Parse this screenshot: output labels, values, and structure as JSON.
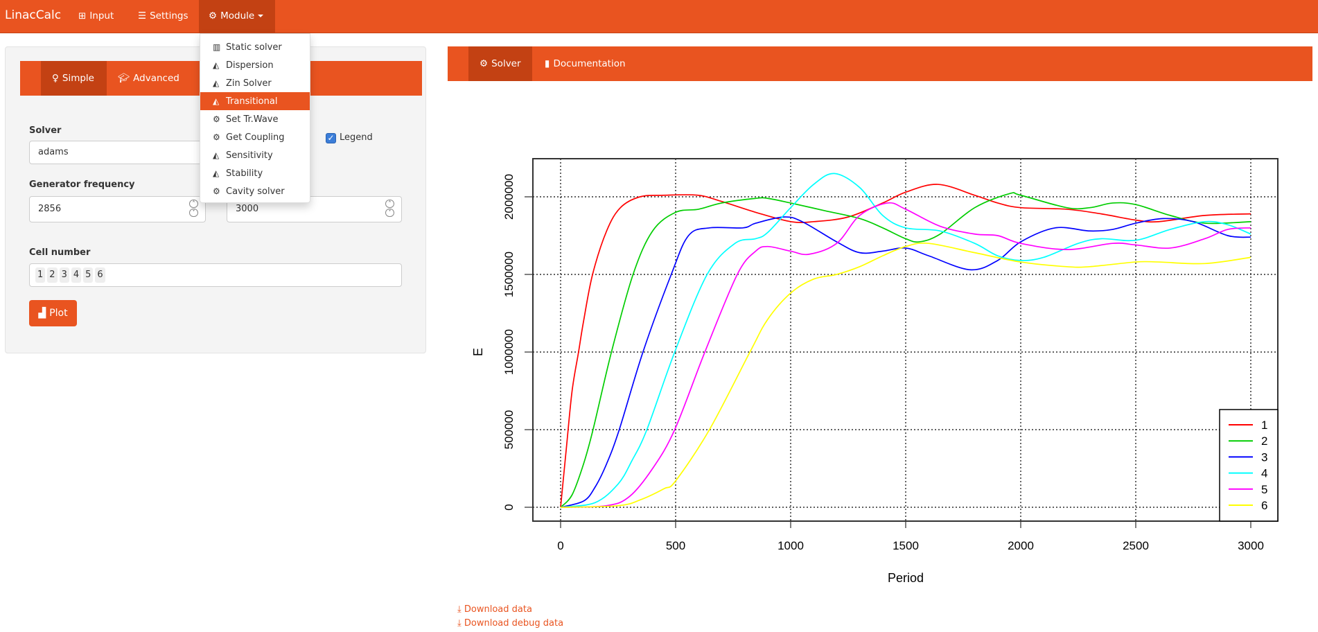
{
  "navbar": {
    "brand": "LinacCalc",
    "items": [
      {
        "label": "Input",
        "icon": "table-icon"
      },
      {
        "label": "Settings",
        "icon": "sliders-icon"
      },
      {
        "label": "Module",
        "icon": "cogs-icon",
        "active": true
      }
    ]
  },
  "module_menu": {
    "items": [
      {
        "label": "Static solver",
        "icon": "bar-chart-icon"
      },
      {
        "label": "Dispersion",
        "icon": "area-chart-icon"
      },
      {
        "label": "Zin Solver",
        "icon": "area-chart-icon"
      },
      {
        "label": "Transitional",
        "icon": "area-chart-icon",
        "active": true
      },
      {
        "label": "Set Tr.Wave",
        "icon": "gear-icon"
      },
      {
        "label": "Get Coupling",
        "icon": "gear-icon"
      },
      {
        "label": "Sensitivity",
        "icon": "area-chart-icon"
      },
      {
        "label": "Stability",
        "icon": "area-chart-icon"
      },
      {
        "label": "Cavity solver",
        "icon": "gear-icon"
      }
    ]
  },
  "left_panel": {
    "tabs": [
      {
        "label": "Simple",
        "icon": "child-icon",
        "active": true
      },
      {
        "label": "Advanced",
        "icon": "graduation-cap-icon"
      },
      {
        "label": "",
        "icon": "list-icon"
      }
    ],
    "solver_label": "Solver",
    "solver_value": "adams",
    "legend_label": "Legend",
    "legend_checked": true,
    "generator_frequency_label": "Generator frequency",
    "generator_frequency_value": "2856",
    "second_value": "3000",
    "cell_number_label": "Cell number",
    "cells": [
      "1",
      "2",
      "3",
      "4",
      "5",
      "6"
    ],
    "plot_button": "Plot"
  },
  "right_panel": {
    "tabs": [
      {
        "label": "Solver",
        "icon": "gear-icon",
        "active": true
      },
      {
        "label": "Documentation",
        "icon": "file-icon"
      }
    ],
    "download_data": "Download data",
    "download_debug": "Download debug data"
  },
  "colors": {
    "brand": "#e95420",
    "brand_dark": "#c34113"
  },
  "chart_data": {
    "type": "line",
    "xlabel": "Period",
    "ylabel": "E",
    "xlim": [
      0,
      3000
    ],
    "ylim": [
      0,
      2150000
    ],
    "xticks": [
      0,
      500,
      1000,
      1500,
      2000,
      2500,
      3000
    ],
    "yticks": [
      0,
      500000,
      1000000,
      1500000,
      2000000
    ],
    "grid": true,
    "legend_position": "bottom-right",
    "series": [
      {
        "name": "1",
        "color": "#ff0000",
        "points": [
          [
            0,
            0
          ],
          [
            25,
            380000
          ],
          [
            50,
            750000
          ],
          [
            78,
            1000000
          ],
          [
            100,
            1200000
          ],
          [
            139,
            1500000
          ],
          [
            200,
            1780000
          ],
          [
            260,
            1930000
          ],
          [
            345,
            2000000
          ],
          [
            450,
            2010000
          ],
          [
            597,
            2010000
          ],
          [
            700,
            1970000
          ],
          [
            848,
            1900000
          ],
          [
            1000,
            1840000
          ],
          [
            1100,
            1840000
          ],
          [
            1250,
            1870000
          ],
          [
            1400,
            1960000
          ],
          [
            1500,
            2030000
          ],
          [
            1640,
            2080000
          ],
          [
            1800,
            2010000
          ],
          [
            1900,
            1960000
          ],
          [
            2000,
            1930000
          ],
          [
            2200,
            1920000
          ],
          [
            2350,
            1890000
          ],
          [
            2500,
            1850000
          ],
          [
            2600,
            1840000
          ],
          [
            2800,
            1880000
          ],
          [
            3000,
            1890000
          ]
        ]
      },
      {
        "name": "2",
        "color": "#00cd00",
        "points": [
          [
            0,
            0
          ],
          [
            50,
            80000
          ],
          [
            100,
            280000
          ],
          [
            141,
            500000
          ],
          [
            221,
            1000000
          ],
          [
            315,
            1500000
          ],
          [
            400,
            1780000
          ],
          [
            500,
            1900000
          ],
          [
            600,
            1920000
          ],
          [
            700,
            1960000
          ],
          [
            848,
            1990000
          ],
          [
            900,
            1990000
          ],
          [
            1000,
            1960000
          ],
          [
            1150,
            1910000
          ],
          [
            1300,
            1860000
          ],
          [
            1400,
            1800000
          ],
          [
            1500,
            1730000
          ],
          [
            1560,
            1710000
          ],
          [
            1650,
            1760000
          ],
          [
            1800,
            1930000
          ],
          [
            1950,
            2020000
          ],
          [
            2000,
            2010000
          ],
          [
            2200,
            1930000
          ],
          [
            2300,
            1930000
          ],
          [
            2400,
            1960000
          ],
          [
            2500,
            1950000
          ],
          [
            2650,
            1880000
          ],
          [
            2800,
            1830000
          ],
          [
            3000,
            1840000
          ]
        ]
      },
      {
        "name": "3",
        "color": "#0000ff",
        "points": [
          [
            0,
            0
          ],
          [
            100,
            40000
          ],
          [
            150,
            130000
          ],
          [
            200,
            280000
          ],
          [
            255,
            500000
          ],
          [
            358,
            1000000
          ],
          [
            481,
            1500000
          ],
          [
            556,
            1750000
          ],
          [
            647,
            1800000
          ],
          [
            793,
            1800000
          ],
          [
            848,
            1830000
          ],
          [
            970,
            1870000
          ],
          [
            1050,
            1840000
          ],
          [
            1200,
            1710000
          ],
          [
            1300,
            1640000
          ],
          [
            1400,
            1650000
          ],
          [
            1500,
            1670000
          ],
          [
            1600,
            1620000
          ],
          [
            1780,
            1530000
          ],
          [
            1900,
            1590000
          ],
          [
            2000,
            1710000
          ],
          [
            2150,
            1800000
          ],
          [
            2300,
            1780000
          ],
          [
            2400,
            1790000
          ],
          [
            2500,
            1830000
          ],
          [
            2620,
            1860000
          ],
          [
            2750,
            1840000
          ],
          [
            2900,
            1750000
          ],
          [
            3000,
            1740000
          ]
        ]
      },
      {
        "name": "4",
        "color": "#00ffff",
        "points": [
          [
            0,
            0
          ],
          [
            150,
            30000
          ],
          [
            250,
            150000
          ],
          [
            310,
            300000
          ],
          [
            375,
            500000
          ],
          [
            496,
            1000000
          ],
          [
            637,
            1500000
          ],
          [
            758,
            1700000
          ],
          [
            848,
            1730000
          ],
          [
            900,
            1770000
          ],
          [
            1000,
            1930000
          ],
          [
            1100,
            2080000
          ],
          [
            1190,
            2150000
          ],
          [
            1300,
            2060000
          ],
          [
            1400,
            1880000
          ],
          [
            1500,
            1800000
          ],
          [
            1650,
            1780000
          ],
          [
            1800,
            1700000
          ],
          [
            1900,
            1620000
          ],
          [
            2000,
            1590000
          ],
          [
            2100,
            1610000
          ],
          [
            2250,
            1700000
          ],
          [
            2350,
            1730000
          ],
          [
            2500,
            1720000
          ],
          [
            2650,
            1790000
          ],
          [
            2800,
            1840000
          ],
          [
            2900,
            1820000
          ],
          [
            3000,
            1760000
          ]
        ]
      },
      {
        "name": "5",
        "color": "#ff00ff",
        "points": [
          [
            0,
            0
          ],
          [
            200,
            10000
          ],
          [
            300,
            70000
          ],
          [
            400,
            250000
          ],
          [
            496,
            500000
          ],
          [
            627,
            1000000
          ],
          [
            768,
            1500000
          ],
          [
            848,
            1650000
          ],
          [
            900,
            1680000
          ],
          [
            1000,
            1650000
          ],
          [
            1080,
            1630000
          ],
          [
            1200,
            1700000
          ],
          [
            1300,
            1880000
          ],
          [
            1420,
            1960000
          ],
          [
            1500,
            1920000
          ],
          [
            1650,
            1810000
          ],
          [
            1800,
            1760000
          ],
          [
            1900,
            1750000
          ],
          [
            2000,
            1700000
          ],
          [
            2200,
            1660000
          ],
          [
            2400,
            1700000
          ],
          [
            2500,
            1690000
          ],
          [
            2650,
            1670000
          ],
          [
            2800,
            1730000
          ],
          [
            2900,
            1790000
          ],
          [
            3000,
            1800000
          ]
        ]
      },
      {
        "name": "6",
        "color": "#ffff00",
        "points": [
          [
            0,
            0
          ],
          [
            250,
            10000
          ],
          [
            350,
            50000
          ],
          [
            450,
            120000
          ],
          [
            500,
            170000
          ],
          [
            647,
            500000
          ],
          [
            823,
            1000000
          ],
          [
            900,
            1210000
          ],
          [
            1000,
            1380000
          ],
          [
            1100,
            1470000
          ],
          [
            1200,
            1500000
          ],
          [
            1300,
            1550000
          ],
          [
            1400,
            1620000
          ],
          [
            1500,
            1680000
          ],
          [
            1600,
            1700000
          ],
          [
            1800,
            1640000
          ],
          [
            2000,
            1580000
          ],
          [
            2200,
            1550000
          ],
          [
            2300,
            1550000
          ],
          [
            2500,
            1580000
          ],
          [
            2600,
            1580000
          ],
          [
            2800,
            1570000
          ],
          [
            3000,
            1610000
          ]
        ]
      }
    ]
  }
}
